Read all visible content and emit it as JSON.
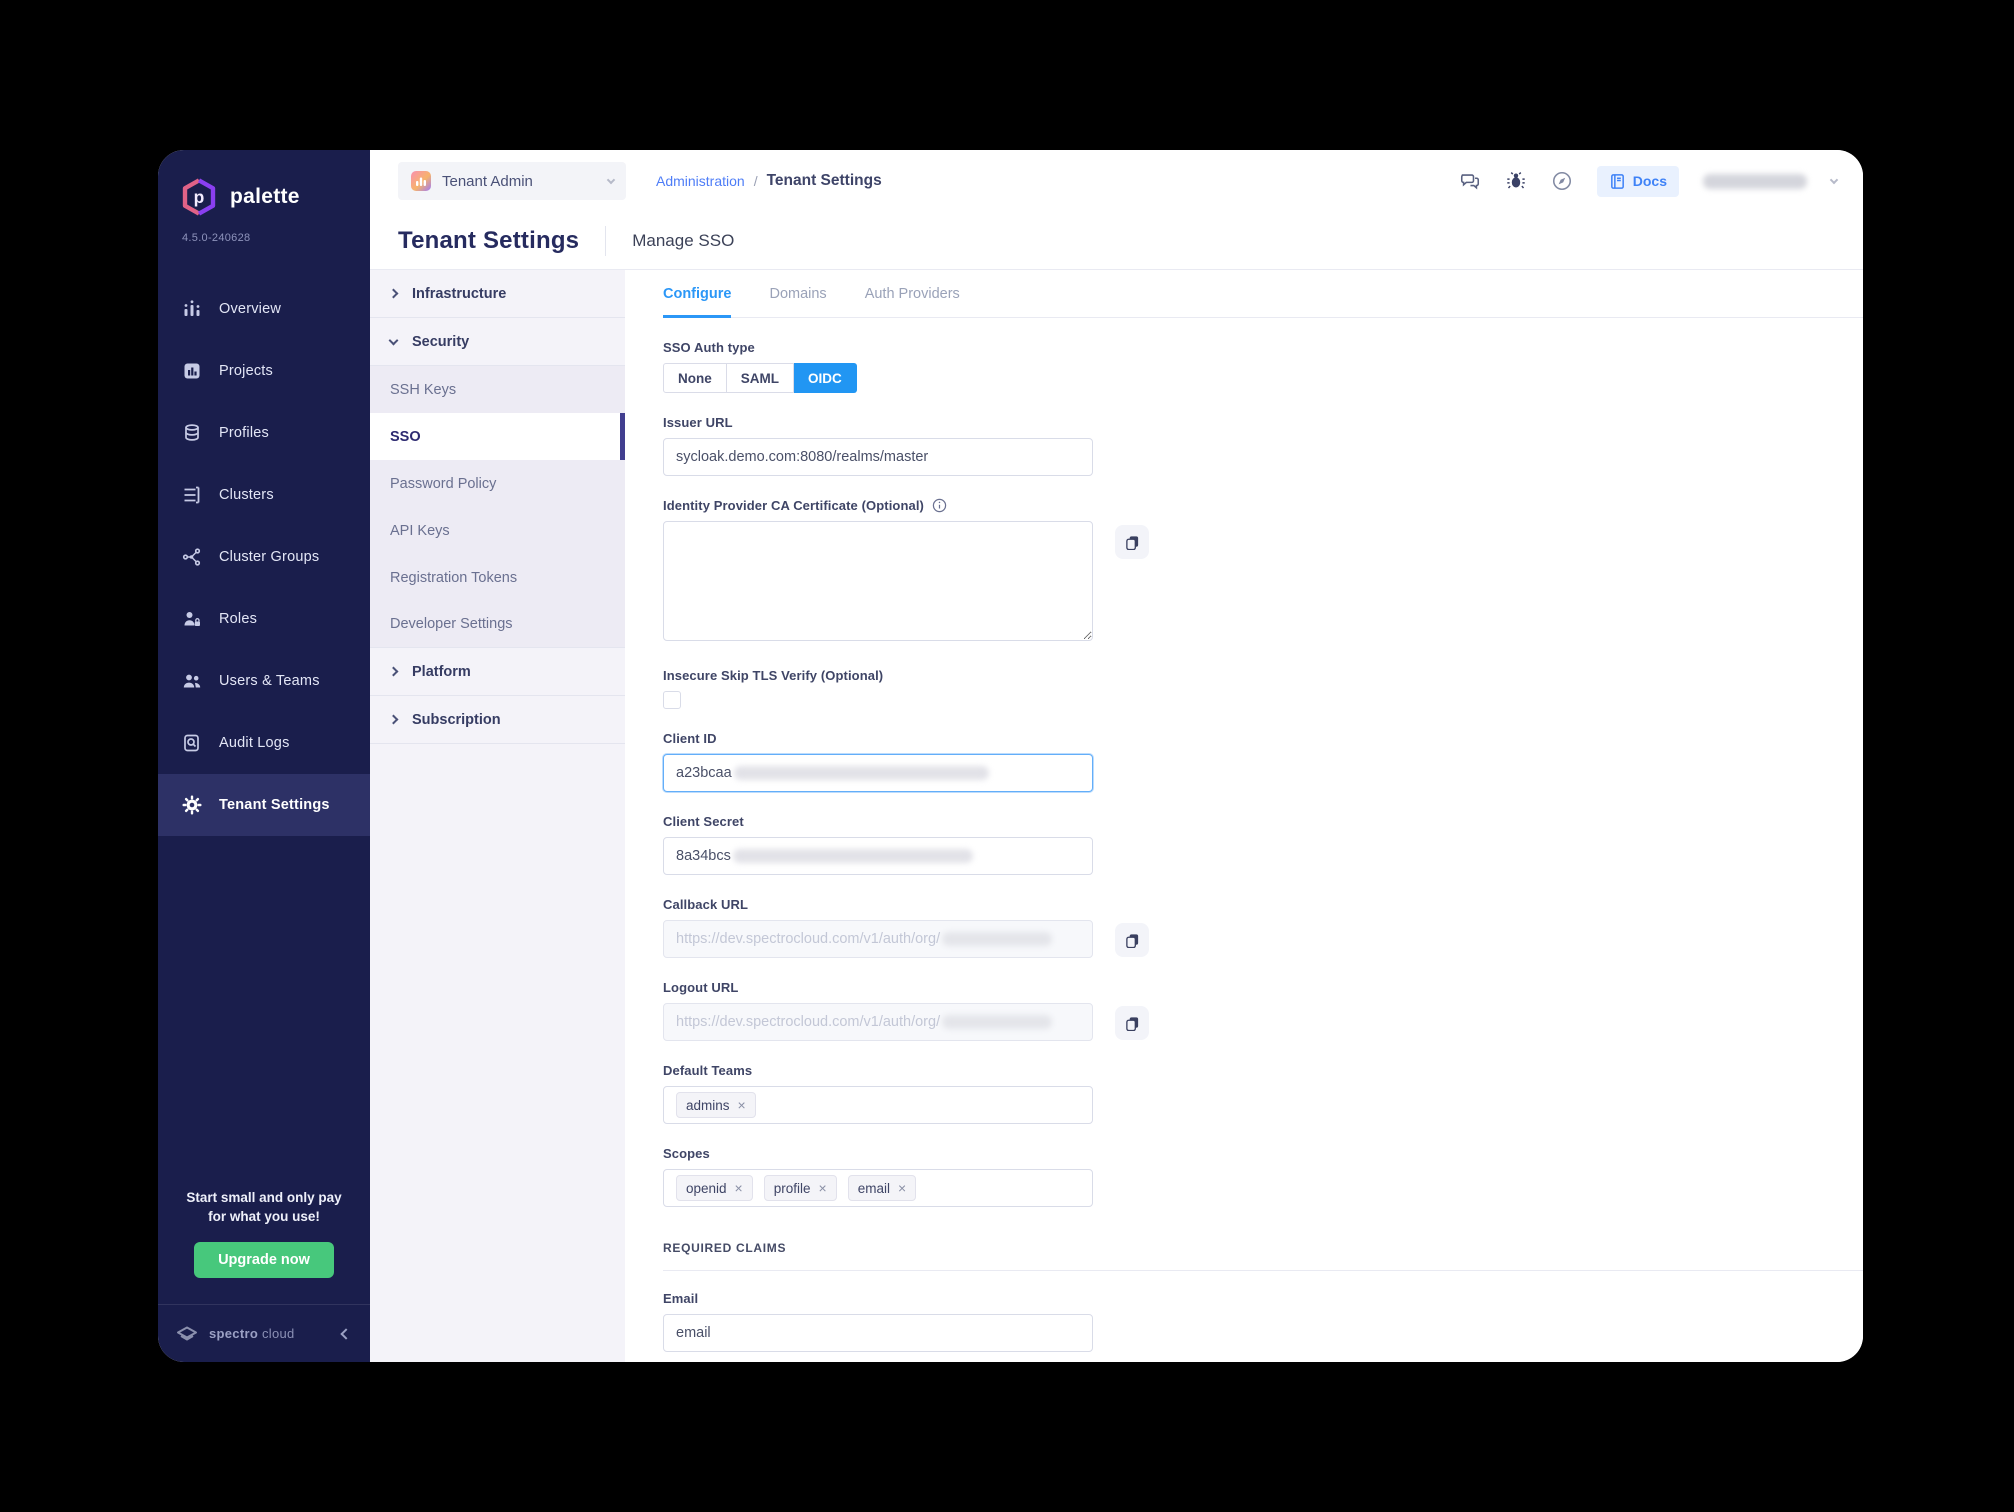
{
  "colors": {
    "accent_blue": "#2196f3",
    "sidebar_navy": "#1a1e4c",
    "upgrade_green": "#47c87c",
    "link_blue": "#4e7df7",
    "active_nav_indicator": "#413e8f"
  },
  "sidebar": {
    "logo_text": "palette",
    "version": "4.5.0-240628",
    "items": [
      {
        "label": "Overview"
      },
      {
        "label": "Projects"
      },
      {
        "label": "Profiles"
      },
      {
        "label": "Clusters"
      },
      {
        "label": "Cluster Groups"
      },
      {
        "label": "Roles"
      },
      {
        "label": "Users & Teams"
      },
      {
        "label": "Audit Logs"
      },
      {
        "label": "Tenant Settings"
      }
    ],
    "active_item": "Tenant Settings",
    "promo": {
      "line1": "Start small and only pay",
      "line2": "for what you use!",
      "button_label": "Upgrade now"
    },
    "footer": {
      "brand_bold": "spectro",
      "brand_light": "cloud"
    }
  },
  "topbar": {
    "scope_selector_label": "Tenant Admin",
    "breadcrumb": {
      "parent": "Administration",
      "separator": "/",
      "current": "Tenant Settings"
    },
    "docs_label": "Docs"
  },
  "page_header": {
    "title": "Tenant Settings",
    "subtitle": "Manage SSO"
  },
  "settings_nav": {
    "groups": [
      {
        "label": "Infrastructure",
        "state": "collapsed"
      },
      {
        "label": "Security",
        "state": "expanded"
      },
      {
        "label": "Platform",
        "state": "collapsed"
      },
      {
        "label": "Subscription",
        "state": "collapsed"
      }
    ],
    "security_items": [
      {
        "label": "SSH Keys"
      },
      {
        "label": "SSO"
      },
      {
        "label": "Password Policy"
      },
      {
        "label": "API Keys"
      },
      {
        "label": "Registration Tokens"
      },
      {
        "label": "Developer Settings"
      }
    ],
    "active_item": "SSO"
  },
  "content": {
    "tabs": [
      {
        "label": "Configure"
      },
      {
        "label": "Domains"
      },
      {
        "label": "Auth Providers"
      }
    ],
    "active_tab": "Configure",
    "sso_auth_type": {
      "label": "SSO Auth type",
      "options": [
        {
          "label": "None"
        },
        {
          "label": "SAML"
        },
        {
          "label": "OIDC"
        }
      ],
      "selected": "OIDC"
    },
    "issuer_url": {
      "label": "Issuer URL",
      "value": "sycloak.demo.com:8080/realms/master"
    },
    "ca_certificate": {
      "label": "Identity Provider CA Certificate (Optional)",
      "value": ""
    },
    "skip_tls": {
      "label": "Insecure Skip TLS Verify (Optional)",
      "checked": false
    },
    "client_id": {
      "label": "Client ID",
      "visible_value": "a23bcaa",
      "redacted": true
    },
    "client_secret": {
      "label": "Client Secret",
      "visible_value": "8a34bcs",
      "redacted": true
    },
    "callback_url": {
      "label": "Callback URL",
      "visible_value": "https://dev.spectrocloud.com/v1/auth/org/",
      "redacted": true,
      "disabled": true
    },
    "logout_url": {
      "label": "Logout URL",
      "visible_value": "https://dev.spectrocloud.com/v1/auth/org/",
      "redacted": true,
      "disabled": true
    },
    "default_teams": {
      "label": "Default Teams",
      "tags": [
        {
          "text": "admins"
        }
      ]
    },
    "scopes": {
      "label": "Scopes",
      "tags": [
        {
          "text": "openid"
        },
        {
          "text": "profile"
        },
        {
          "text": "email"
        }
      ]
    },
    "required_claims_heading": "REQUIRED CLAIMS",
    "email_claim": {
      "label": "Email",
      "value": "email"
    }
  }
}
